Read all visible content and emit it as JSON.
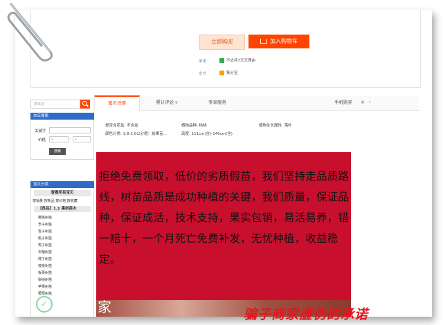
{
  "product": {
    "buy_now": "立即购买",
    "add_cart": "加入购物车",
    "promise_label": "承诺",
    "promise_value": "不支持7天无理由",
    "pay_label": "支付",
    "pay_value": "集分宝"
  },
  "sidebar": {
    "search_placeholder": "搜本店",
    "shop_search_title": "本店搜索",
    "keyword_label": "关键字",
    "price_label": "价格",
    "currency": "¥",
    "search_button": "搜索",
    "category_title": "宝贝分类",
    "view_all": "查看所有宝贝",
    "sort_links": "按销量 按新品 按价格 按收藏",
    "group_title": "【良品】1.1 果树苗木",
    "items": [
      "樱桃树苗",
      "李子树苗",
      "杏子树苗",
      "桃子树苗",
      "枣子树苗",
      "石榴树苗",
      "柿子树苗",
      "核桃树苗",
      "板栗树苗",
      "梨树树苗",
      "苹果树苗",
      "葡萄树苗"
    ]
  },
  "tabs": [
    {
      "label": "宝贝详情"
    },
    {
      "label": "累计评论",
      "badge": "0"
    },
    {
      "label": "专享服务"
    },
    {
      "label": "手机购买"
    }
  ],
  "attributes": {
    "a1": "是否含花盆: 不含盆",
    "a2": "植物品种: 桃桃",
    "a3": "植物生长属性: 落叶",
    "a4": "颜色分类: 1.8-2.0公分粗：结果苗...",
    "a5": "高度: 111cm(含)-140cm(含)"
  },
  "banner": {
    "text": "拒绝免费领取，低价的劣质假苗，我们坚持走品质路线，树苗品质是成功种植的关键，我们质量，保证品种，保证成活，技术支持，果实包销，易活易养，错一赔十，一个月死亡免费补发，无忧种植，收益稳定。",
    "photo_char": "家"
  },
  "slogan": "骗子商家虚伪的承诺",
  "colors": {
    "accent": "#ff4400",
    "banner": "#c8102e",
    "sidebar_head": "#2f6cc8"
  }
}
